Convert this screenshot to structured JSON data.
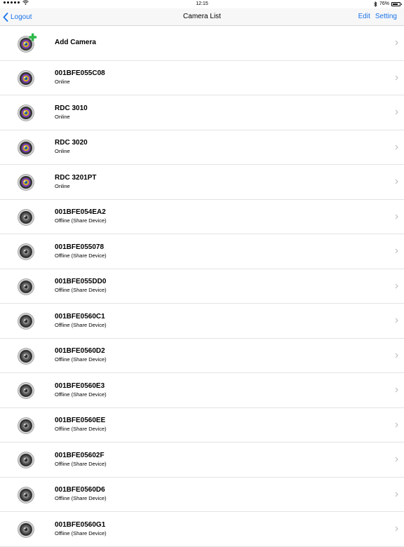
{
  "status_bar": {
    "time": "12:15",
    "battery": "76%",
    "battery_level": 0.76
  },
  "nav": {
    "back_label": "Logout",
    "title": "Camera List",
    "edit_label": "Edit",
    "setting_label": "Setting"
  },
  "add_row": {
    "label": "Add Camera",
    "icon": "add-camera-icon"
  },
  "cameras": [
    {
      "name": "001BFE055C08",
      "status": "Online",
      "state": "online"
    },
    {
      "name": "RDC 3010",
      "status": "Online",
      "state": "online"
    },
    {
      "name": "RDC 3020",
      "status": "Online",
      "state": "online"
    },
    {
      "name": "RDC 3201PT",
      "status": "Online",
      "state": "online"
    },
    {
      "name": "001BFE054EA2",
      "status": "Offline (Share Device)",
      "state": "offline"
    },
    {
      "name": "001BFE055078",
      "status": "Offline (Share Device)",
      "state": "offline"
    },
    {
      "name": "001BFE055DD0",
      "status": "Offline (Share Device)",
      "state": "offline"
    },
    {
      "name": "001BFE0560C1",
      "status": "Offline (Share Device)",
      "state": "offline"
    },
    {
      "name": "001BFE0560D2",
      "status": "Offline (Share Device)",
      "state": "offline"
    },
    {
      "name": "001BFE0560E3",
      "status": "Offline (Share Device)",
      "state": "offline"
    },
    {
      "name": "001BFE0560EE",
      "status": "Offline (Share Device)",
      "state": "offline"
    },
    {
      "name": "001BFE05602F",
      "status": "Offline (Share Device)",
      "state": "offline"
    },
    {
      "name": "001BFE0560D6",
      "status": "Offline (Share Device)",
      "state": "offline"
    },
    {
      "name": "001BFE0560G1",
      "status": "Offline (Share Device)",
      "state": "offline"
    }
  ],
  "colors": {
    "accent": "#1a73e8",
    "add_badge": "#2db84a"
  }
}
